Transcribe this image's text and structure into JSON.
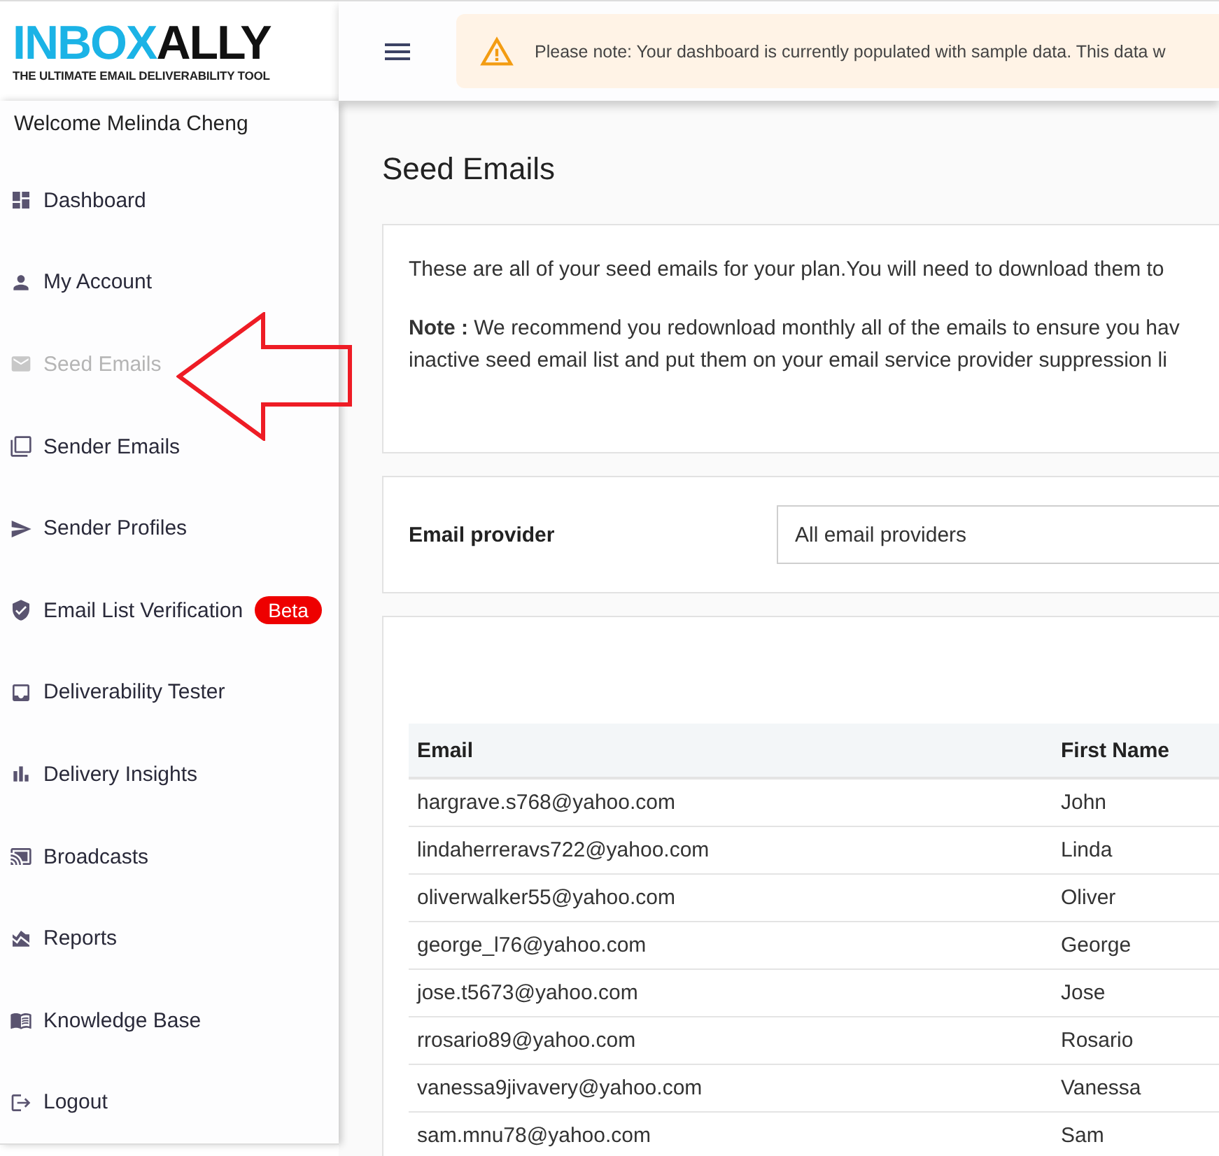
{
  "logo": {
    "wordmark_part_1": "INBOX",
    "wordmark_part_2": "ALLY",
    "tagline": "THE ULTIMATE EMAIL DELIVERABILITY TOOL"
  },
  "notice": {
    "text": "Please note: Your dashboard is currently populated with sample data. This data w"
  },
  "welcome": "Welcome Melinda Cheng",
  "sidebar": {
    "items": [
      {
        "label": "Dashboard",
        "selected": false
      },
      {
        "label": "My Account",
        "selected": false
      },
      {
        "label": "Seed Emails",
        "selected": true
      },
      {
        "label": "Sender Emails",
        "selected": false
      },
      {
        "label": "Sender Profiles",
        "selected": false
      },
      {
        "label": "Email List Verification",
        "selected": false,
        "badge": "Beta"
      },
      {
        "label": "Deliverability Tester",
        "selected": false
      },
      {
        "label": "Delivery Insights",
        "selected": false
      },
      {
        "label": "Broadcasts",
        "selected": false
      },
      {
        "label": "Reports",
        "selected": false
      },
      {
        "label": "Knowledge Base",
        "selected": false
      },
      {
        "label": "Logout",
        "selected": false
      }
    ]
  },
  "page_title": "Seed Emails",
  "intro": {
    "text": "These are all of your seed emails for your plan.You will need to download them to",
    "note": "**Note :** We recommend you redownload monthly all of the emails to ensure you hav",
    "note_line_2": "inactive seed email list and put them on your email service provider suppression li"
  },
  "filter": {
    "label": "Email provider",
    "value": "All email providers"
  },
  "table": {
    "columns": [
      "Email",
      "First Name"
    ],
    "rows": [
      [
        "hargrave.s768@yahoo.com",
        "John"
      ],
      [
        "lindaherreravs722@yahoo.com",
        "Linda"
      ],
      [
        "oliverwalker55@yahoo.com",
        "Oliver"
      ],
      [
        "george_l76@yahoo.com",
        "George"
      ],
      [
        "jose.t5673@yahoo.com",
        "Jose"
      ],
      [
        "rrosario89@yahoo.com",
        "Rosario"
      ],
      [
        "vanessa9jivavery@yahoo.com",
        "Vanessa"
      ],
      [
        "sam.mnu78@yahoo.com",
        "Sam"
      ]
    ]
  }
}
